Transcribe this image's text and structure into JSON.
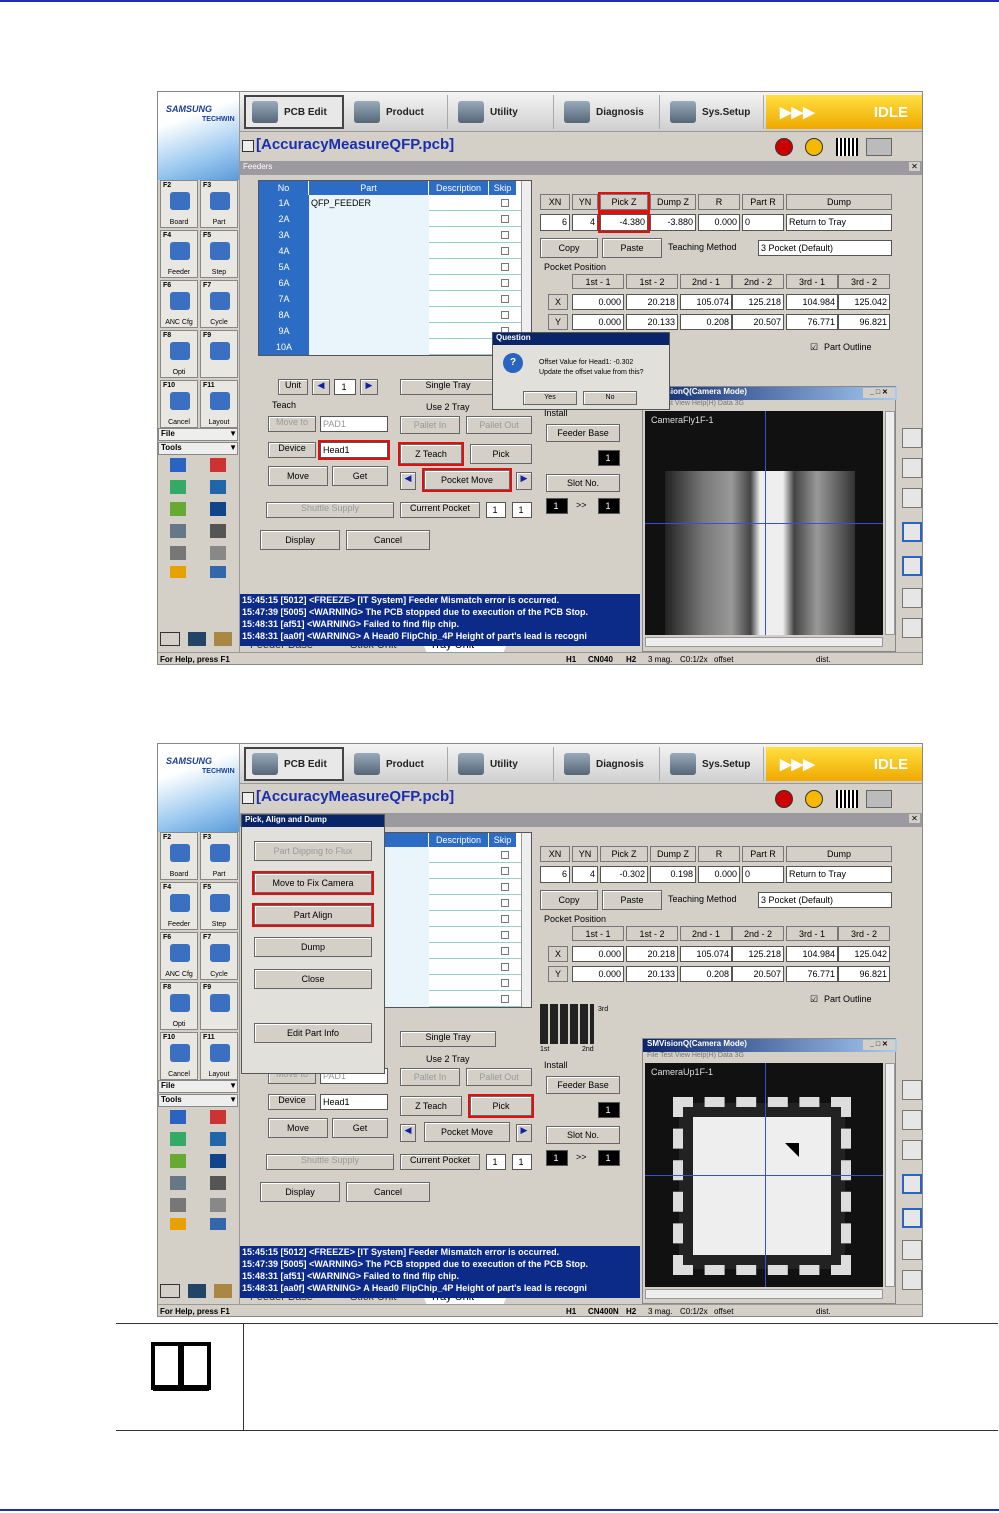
{
  "app": {
    "toolbar": [
      "PCB Edit",
      "Product",
      "Utility",
      "Diagnosis",
      "Sys.Setup"
    ],
    "status_badge": "IDLE",
    "brand": "SAMSUNG",
    "brand_sub": "TECHWIN",
    "file_title": "[AccuracyMeasureQFP.pcb]",
    "fkeys": [
      {
        "key": "F2",
        "label": "Board"
      },
      {
        "key": "F3",
        "label": "Part"
      },
      {
        "key": "F4",
        "label": "Feeder"
      },
      {
        "key": "F5",
        "label": "Step"
      },
      {
        "key": "F6",
        "label": "ANC Cfg"
      },
      {
        "key": "F7",
        "label": "Cycle"
      },
      {
        "key": "F8",
        "label": "Opti"
      },
      {
        "key": "F9",
        "label": ""
      },
      {
        "key": "F10",
        "label": "Cancel"
      },
      {
        "key": "F11",
        "label": "Layout"
      }
    ],
    "side_menu": [
      "File",
      "Tools"
    ],
    "help": "For Help, press F1",
    "panel_title": "Feeders",
    "grid_headers": [
      "No",
      "Part",
      "Description",
      "Skip"
    ],
    "rows": [
      "1A",
      "2A",
      "3A",
      "4A",
      "5A",
      "6A",
      "7A",
      "8A",
      "9A",
      "10A"
    ],
    "row1_part": "QFP_FEEDER",
    "xn_headers": [
      "XN",
      "YN",
      "Pick Z",
      "Dump Z",
      "R",
      "Part R",
      "Dump"
    ],
    "copy": "Copy",
    "paste": "Paste",
    "teaching_method_label": "Teaching Method",
    "teaching_method": "3 Pocket (Default)",
    "pocket_position": "Pocket Position",
    "pp_headers": [
      "1st - 1",
      "1st - 2",
      "2nd - 1",
      "2nd - 2",
      "3rd - 1",
      "3rd - 2"
    ],
    "pp_x": [
      "0.000",
      "20.218",
      "105.074",
      "125.218",
      "104.984",
      "125.042"
    ],
    "pp_y": [
      "0.000",
      "20.133",
      "0.208",
      "20.507",
      "76.771",
      "96.821"
    ],
    "part_outline": "Part Outline",
    "unit": "Unit",
    "unit_val": "1",
    "single_tray": "Single Tray",
    "use2tray": "Use 2 Tray",
    "teach": "Teach",
    "move_to": "Move to",
    "pad": "PAD1",
    "device": "Device",
    "head": "Head1",
    "move": "Move",
    "get": "Get",
    "pallet_in": "Pallet In",
    "pallet_out": "Pallet Out",
    "z_teach": "Z Teach",
    "pick": "Pick",
    "pocket_move": "Pocket Move",
    "install": "Install",
    "feeder_base": "Feeder Base",
    "slot_no": "Slot No.",
    "one": "1",
    "arrows": ">>",
    "shuttle": "Shuttle Supply",
    "current_pocket": "Current Pocket",
    "display": "Display",
    "cancel": "Cancel",
    "tabs": [
      "Feeder Base",
      "Stick Unit",
      "Tray Unit"
    ],
    "log": [
      "15:45:15 [5012] <FREEZE> [IT System] Feeder Mismatch error is occurred.",
      "15:47:39 [5005] <WARNING> The PCB stopped due to execution of the PCB Stop.",
      "15:48:31 [af51] <WARNING> Failed to find flip chip.",
      "15:48:31 [aa0f] <WARNING> A Head0 FlipChip_4P Height of part's lead is recogni"
    ],
    "cam_title": "SMVisionQ(Camera Mode)",
    "cam_menu": "File  Test  View  Help(H)  Data  3G",
    "status_bits": [
      "H1",
      "H2",
      "3 mag.",
      "C0:1/2x",
      "offset",
      "dist."
    ],
    "dump": "Return to Tray",
    "part_r": "0"
  },
  "shot1": {
    "values": [
      "6",
      "4",
      "-4.380",
      "-3.880",
      "0.000"
    ],
    "dialog_title": "Question",
    "dialog_text1": "Offset Value for Head1: -0.302",
    "dialog_text2": "Update the offset value from this?",
    "yes": "Yes",
    "no": "No",
    "camera": "CameraFly1F-1",
    "cn": "CN040"
  },
  "shot2": {
    "values": [
      "6",
      "4",
      "-0.302",
      "0.198",
      "0.000"
    ],
    "popup_title": "Pick, Align and Dump",
    "popup_buttons": [
      "Part Dipping to Flux",
      "Move to Fix Camera",
      "Part Align",
      "Dump",
      "Close",
      "Edit Part Info"
    ],
    "tray_labels": [
      "3rd",
      "1st",
      "2nd"
    ],
    "camera": "CameraUp1F-1",
    "cn": "CN400N"
  }
}
